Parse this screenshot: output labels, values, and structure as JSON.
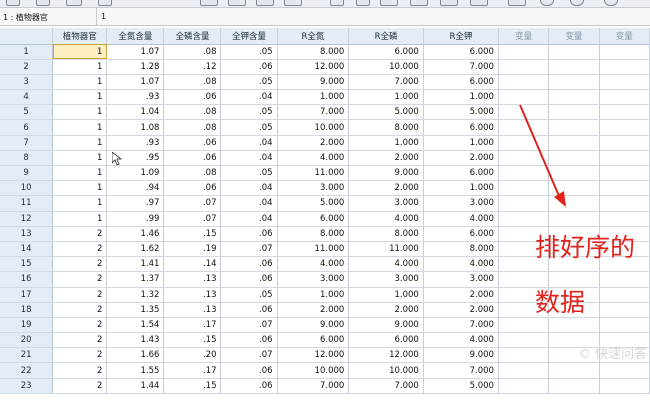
{
  "cell_reference": {
    "label": "1 : 植物器官",
    "value": "1"
  },
  "columns": [
    "植物器官",
    "全氮含量",
    "全磷含量",
    "全钾含量",
    "R全氮",
    "R全磷",
    "R全钾",
    "变量",
    "变量",
    "变量"
  ],
  "rows": [
    [
      "1",
      "1",
      "1.07",
      ".08",
      ".05",
      "8.000",
      "6.000",
      "6.000"
    ],
    [
      "2",
      "1",
      "1.28",
      ".12",
      ".06",
      "12.000",
      "10.000",
      "7.000"
    ],
    [
      "3",
      "1",
      "1.07",
      ".08",
      ".05",
      "9.000",
      "7.000",
      "6.000"
    ],
    [
      "4",
      "1",
      ".93",
      ".06",
      ".04",
      "1.000",
      "1.000",
      "1.000"
    ],
    [
      "5",
      "1",
      "1.04",
      ".08",
      ".05",
      "7.000",
      "5.000",
      "5.000"
    ],
    [
      "6",
      "1",
      "1.08",
      ".08",
      ".05",
      "10.000",
      "8.000",
      "6.000"
    ],
    [
      "7",
      "1",
      ".93",
      ".06",
      ".04",
      "2.000",
      "1.000",
      "1.000"
    ],
    [
      "8",
      "1",
      ".95",
      ".06",
      ".04",
      "4.000",
      "2.000",
      "2.000"
    ],
    [
      "9",
      "1",
      "1.09",
      ".08",
      ".05",
      "11.000",
      "9.000",
      "6.000"
    ],
    [
      "10",
      "1",
      ".94",
      ".06",
      ".04",
      "3.000",
      "2.000",
      "1.000"
    ],
    [
      "11",
      "1",
      ".97",
      ".07",
      ".04",
      "5.000",
      "3.000",
      "3.000"
    ],
    [
      "12",
      "1",
      ".99",
      ".07",
      ".04",
      "6.000",
      "4.000",
      "4.000"
    ],
    [
      "13",
      "2",
      "1.46",
      ".15",
      ".06",
      "8.000",
      "8.000",
      "6.000"
    ],
    [
      "14",
      "2",
      "1.62",
      ".19",
      ".07",
      "11.000",
      "11.000",
      "8.000"
    ],
    [
      "15",
      "2",
      "1.41",
      ".14",
      ".06",
      "4.000",
      "4.000",
      "4.000"
    ],
    [
      "16",
      "2",
      "1.37",
      ".13",
      ".06",
      "3.000",
      "3.000",
      "3.000"
    ],
    [
      "17",
      "2",
      "1.32",
      ".13",
      ".05",
      "1.000",
      "1.000",
      "2.000"
    ],
    [
      "18",
      "2",
      "1.35",
      ".13",
      ".06",
      "2.000",
      "2.000",
      "2.000"
    ],
    [
      "19",
      "2",
      "1.54",
      ".17",
      ".07",
      "9.000",
      "9.000",
      "7.000"
    ],
    [
      "20",
      "2",
      "1.43",
      ".15",
      ".06",
      "6.000",
      "6.000",
      "4.000"
    ],
    [
      "21",
      "2",
      "1.66",
      ".20",
      ".07",
      "12.000",
      "12.000",
      "9.000"
    ],
    [
      "22",
      "2",
      "1.55",
      ".17",
      ".06",
      "10.000",
      "10.000",
      "7.000"
    ],
    [
      "23",
      "2",
      "1.44",
      ".15",
      ".06",
      "7.000",
      "7.000",
      "5.000"
    ]
  ],
  "annotation": {
    "line1": "排好序的",
    "line2": "数据",
    "color": "#e1231c"
  },
  "watermark": "© 快速问答",
  "colors": {
    "header_bg": "#e4ecf7",
    "selected_cell": "#fdf0c3",
    "toolbar_bg": "#eceff4"
  }
}
